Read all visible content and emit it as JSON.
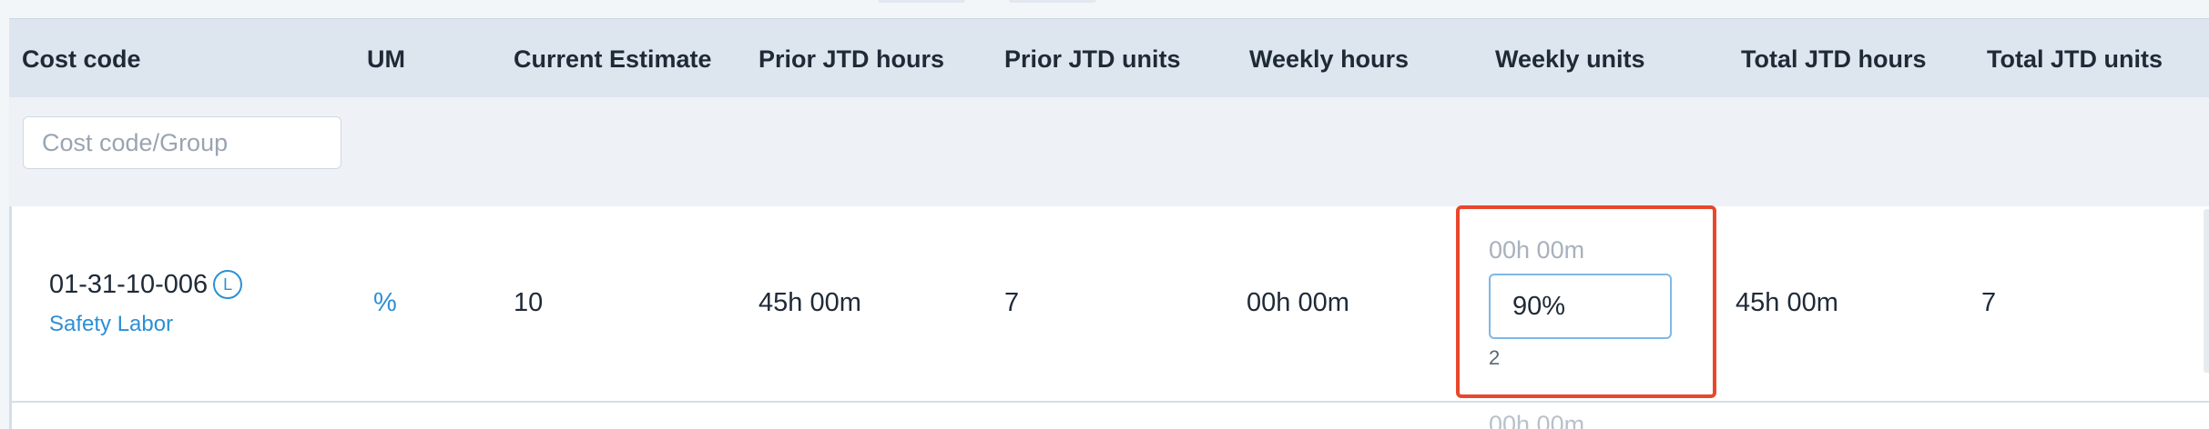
{
  "table": {
    "columns": [
      "Cost code",
      "UM",
      "Current Estimate",
      "Prior JTD hours",
      "Prior JTD units",
      "Weekly hours",
      "Weekly units",
      "Total JTD hours",
      "Total JTD units"
    ],
    "filter": {
      "placeholder": "Cost code/Group",
      "value": ""
    },
    "rows": [
      {
        "cost_code": "01-31-10-006",
        "badge": "L",
        "description": "Safety Labor",
        "um": "%",
        "current_estimate": "10",
        "prior_jtd_hours": "45h 00m",
        "prior_jtd_units": "7",
        "weekly_hours": "00h 00m",
        "weekly_units": {
          "hours_placeholder": "00h 00m",
          "input_value": "90%",
          "count": "2"
        },
        "total_jtd_hours": "45h 00m",
        "total_jtd_units": "7"
      }
    ],
    "next_row": {
      "hours_placeholder": "00h 00m"
    }
  },
  "colors": {
    "header_bg": "#dde6ef",
    "filter_bg": "#eef2f7",
    "link": "#2d8fd5",
    "highlight": "#e8472c",
    "input_border": "#7fb8e6"
  }
}
